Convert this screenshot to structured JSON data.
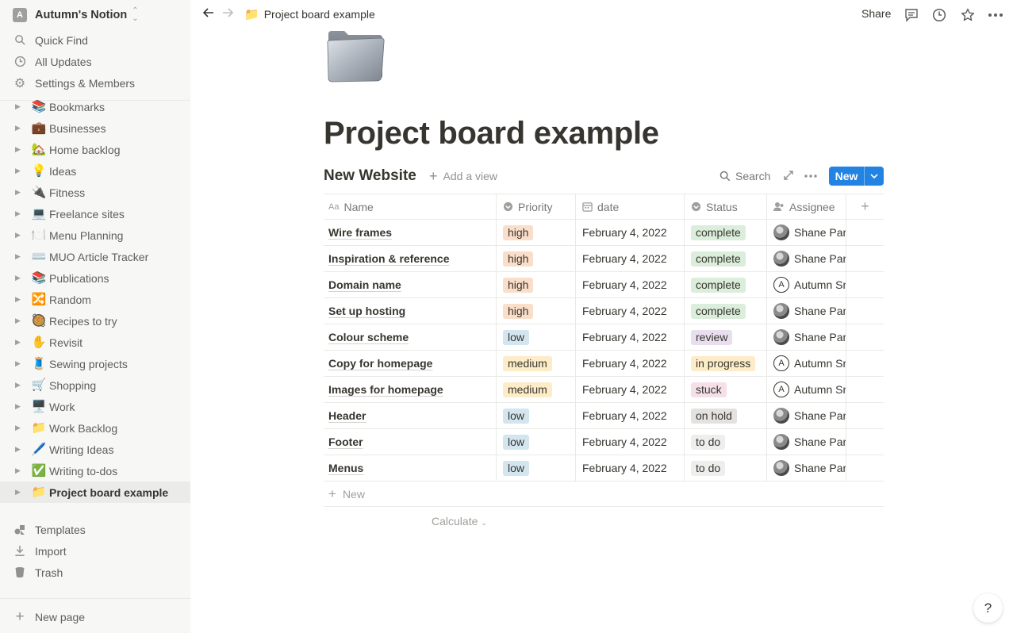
{
  "workspace": {
    "initial": "A",
    "name": "Autumn's Notion"
  },
  "sidebar": {
    "top": [
      {
        "icon": "search-icon",
        "label": "Quick Find"
      },
      {
        "icon": "clock-icon",
        "label": "All Updates"
      },
      {
        "icon": "gear-icon",
        "label": "Settings & Members"
      }
    ],
    "pages": [
      {
        "emoji": "📚",
        "label": "Bookmarks"
      },
      {
        "emoji": "💼",
        "label": "Businesses"
      },
      {
        "emoji": "🏡",
        "label": "Home backlog"
      },
      {
        "emoji": "💡",
        "label": "Ideas"
      },
      {
        "emoji": "🔌",
        "label": "Fitness"
      },
      {
        "emoji": "💻",
        "label": "Freelance sites"
      },
      {
        "emoji": "🍽️",
        "label": "Menu Planning"
      },
      {
        "emoji": "⌨️",
        "label": "MUO Article Tracker"
      },
      {
        "emoji": "📚",
        "label": "Publications"
      },
      {
        "emoji": "🔀",
        "label": "Random"
      },
      {
        "emoji": "🥘",
        "label": "Recipes to try"
      },
      {
        "emoji": "✋",
        "label": "Revisit"
      },
      {
        "emoji": "🧵",
        "label": "Sewing projects"
      },
      {
        "emoji": "🛒",
        "label": "Shopping"
      },
      {
        "emoji": "🖥️",
        "label": "Work"
      },
      {
        "emoji": "📁",
        "label": "Work Backlog"
      },
      {
        "emoji": "🖊️",
        "label": "Writing Ideas"
      },
      {
        "emoji": "✅",
        "label": "Writing to-dos"
      },
      {
        "emoji": "📁",
        "label": "Project board example"
      }
    ],
    "bottom": [
      {
        "icon": "templates-icon",
        "label": "Templates"
      },
      {
        "icon": "import-icon",
        "label": "Import"
      },
      {
        "icon": "trash-icon",
        "label": "Trash"
      }
    ],
    "new_page": "New page"
  },
  "topbar": {
    "breadcrumb_emoji": "📁",
    "breadcrumb": "Project board example",
    "share": "Share"
  },
  "page": {
    "title": "Project board example",
    "db_title": "New Website",
    "add_view": "Add a view",
    "search": "Search",
    "new_button": "New"
  },
  "table": {
    "columns": [
      "Name",
      "Priority",
      "date",
      "Status",
      "Assignee"
    ],
    "rows": [
      {
        "name": "Wire frames",
        "priority": "high",
        "date": "February 4, 2022",
        "status": "complete",
        "assignee": "Shane Par",
        "avatar": "photo"
      },
      {
        "name": "Inspiration & reference",
        "priority": "high",
        "date": "February 4, 2022",
        "status": "complete",
        "assignee": "Shane Par",
        "avatar": "photo"
      },
      {
        "name": "Domain name",
        "priority": "high",
        "date": "February 4, 2022",
        "status": "complete",
        "assignee": "Autumn Sr",
        "avatar": "A"
      },
      {
        "name": "Set up hosting",
        "priority": "high",
        "date": "February 4, 2022",
        "status": "complete",
        "assignee": "Shane Par",
        "avatar": "photo"
      },
      {
        "name": "Colour scheme",
        "priority": "low",
        "date": "February 4, 2022",
        "status": "review",
        "assignee": "Shane Par",
        "avatar": "photo"
      },
      {
        "name": "Copy for homepage",
        "priority": "medium",
        "date": "February 4, 2022",
        "status": "in progress",
        "assignee": "Autumn Sr",
        "avatar": "A"
      },
      {
        "name": "Images for homepage",
        "priority": "medium",
        "date": "February 4, 2022",
        "status": "stuck",
        "assignee": "Autumn Sr",
        "avatar": "A"
      },
      {
        "name": "Header",
        "priority": "low",
        "date": "February 4, 2022",
        "status": "on hold",
        "assignee": "Shane Par",
        "avatar": "photo"
      },
      {
        "name": "Footer",
        "priority": "low",
        "date": "February 4, 2022",
        "status": "to do",
        "assignee": "Shane Par",
        "avatar": "photo"
      },
      {
        "name": "Menus",
        "priority": "low",
        "date": "February 4, 2022",
        "status": "to do",
        "assignee": "Shane Par",
        "avatar": "photo"
      }
    ],
    "add_row": "New",
    "calculate": "Calculate"
  },
  "help": "?"
}
